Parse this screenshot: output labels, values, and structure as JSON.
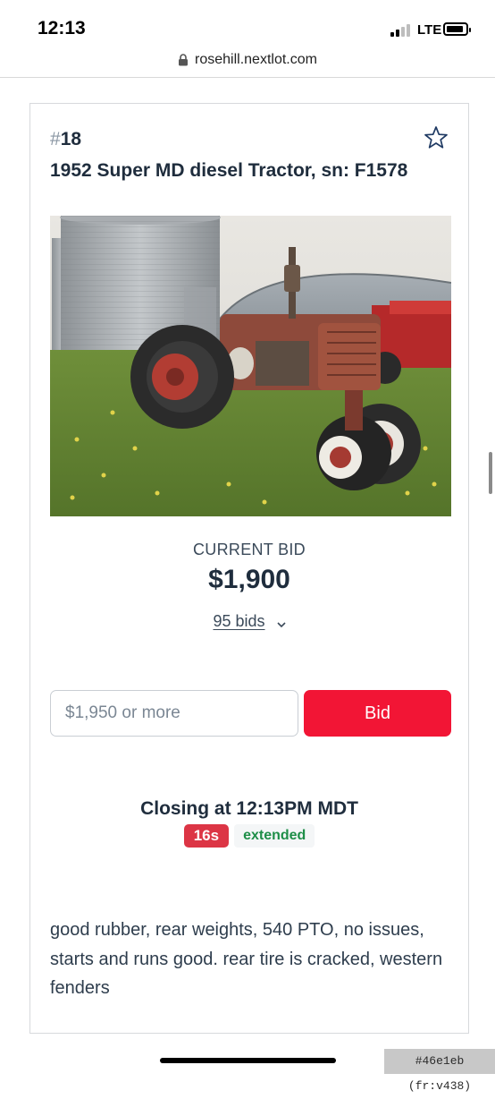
{
  "status_bar": {
    "time": "12:13",
    "network": "LTE",
    "signal_bars_active": 2,
    "signal_bars_total": 4
  },
  "browser": {
    "url": "rosehill.nextlot.com"
  },
  "lot": {
    "hash": "#",
    "number": "18",
    "title": "1952 Super MD diesel Tractor, sn: F1578",
    "photo_subject": "tractor-photo",
    "current_bid_label": "CURRENT BID",
    "current_bid_value": "$1,900",
    "bids_count_label": "95 bids",
    "bid_placeholder": "$1,950 or more",
    "bid_button_label": "Bid",
    "closing_text": "Closing at 12:13PM MDT",
    "timer": "16s",
    "timer_status": "extended",
    "description": "good rubber, rear weights, 540 PTO, no issues, starts and runs good. rear tire is cracked, western fenders"
  },
  "footer": {
    "version_tag": "#46e1eb (fr:v438)"
  },
  "colors": {
    "bid_button": "#f21535",
    "timer_badge": "#dc3545",
    "extended_text": "#1e8e48",
    "text_dark": "#1f2d3d"
  }
}
